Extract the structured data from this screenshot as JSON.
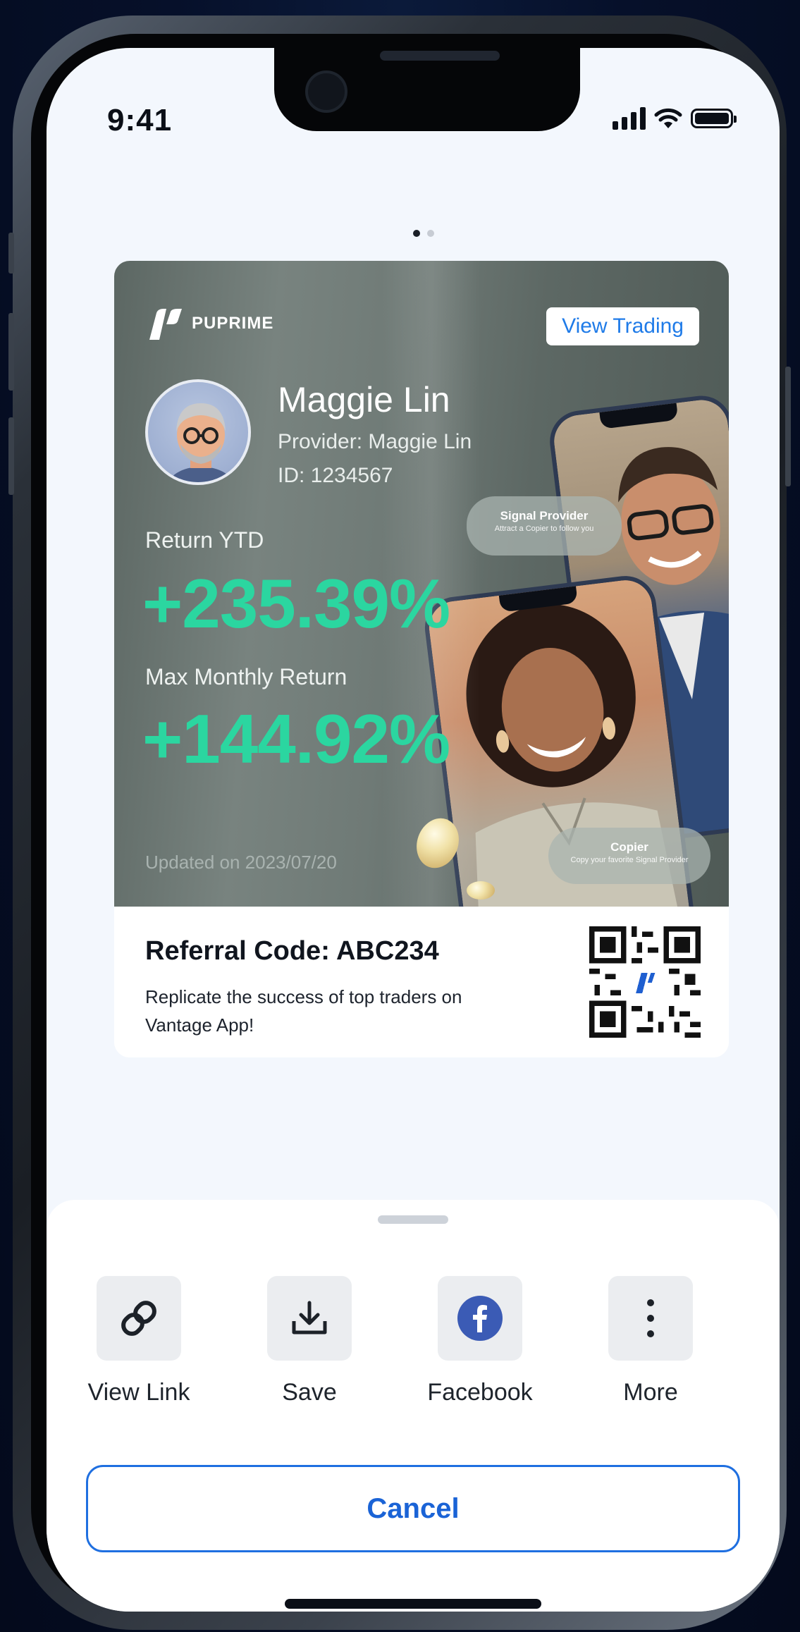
{
  "status_bar": {
    "time": "9:41"
  },
  "card": {
    "brand": "PUPRIME",
    "view_trading_label": "View Trading",
    "trader_name": "Maggie Lin",
    "provider_line": "Provider:  Maggie Lin",
    "id_line": "ID: 1234567",
    "return_label": "Return YTD",
    "return_value": "+235.39%",
    "max_label": "Max Monthly Return",
    "max_value": "+144.92%",
    "updated": "Updated on 2023/07/20",
    "signal_pill": {
      "title": "Signal Provider",
      "subtitle": "Attract a Copier to follow you"
    },
    "copier_pill": {
      "title": "Copier",
      "subtitle": "Copy your favorite Signal Provider"
    },
    "referral_title": "Referral Code: ABC234",
    "referral_desc": "Replicate the success of top traders on Vantage App!"
  },
  "share_sheet": {
    "items": [
      {
        "label": "View Link",
        "icon": "link-icon"
      },
      {
        "label": "Save",
        "icon": "download-icon"
      },
      {
        "label": "Facebook",
        "icon": "facebook-icon"
      },
      {
        "label": "More",
        "icon": "more-vertical-icon"
      }
    ],
    "cancel_label": "Cancel"
  },
  "colors": {
    "accent_blue": "#1f6fe0",
    "return_green": "#2bd6a0",
    "facebook_blue": "#3b5bb5"
  }
}
